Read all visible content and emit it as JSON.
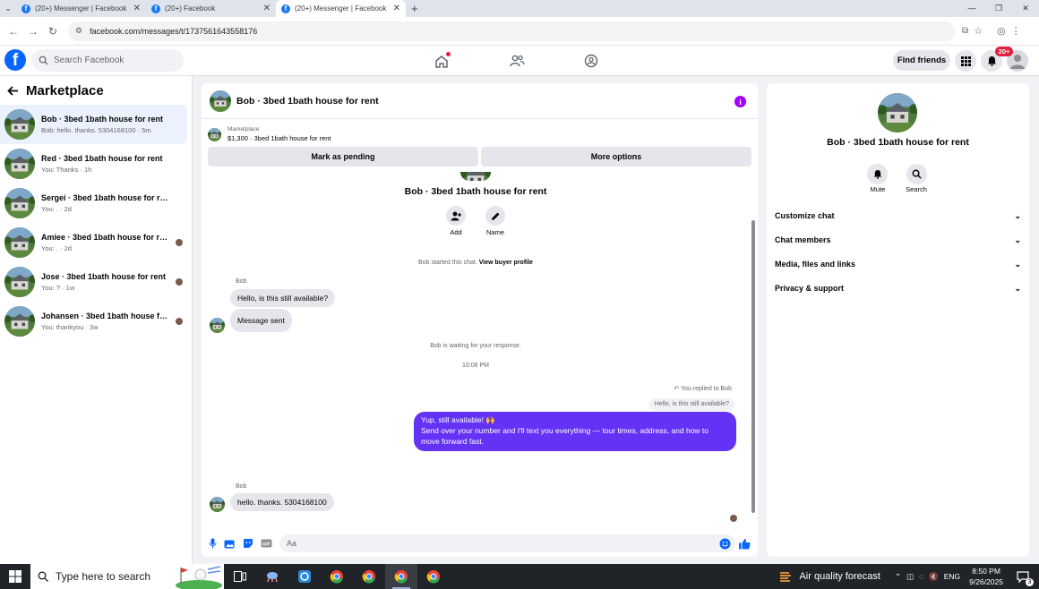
{
  "browser": {
    "tabs": [
      {
        "title": "(20+) Messenger | Facebook",
        "active": false
      },
      {
        "title": "(20+) Facebook",
        "active": false
      },
      {
        "title": "(20+) Messenger | Facebook",
        "active": true
      }
    ],
    "url": "facebook.com/messages/t/1737561643558176"
  },
  "header": {
    "search_placeholder": "Search Facebook",
    "find_friends": "Find friends",
    "notification_badge": "20+",
    "logo_letter": "f"
  },
  "sidebar": {
    "title": "Marketplace",
    "conversations": [
      {
        "name": "Bob · 3bed 1bath house for rent",
        "preview": "Bob: hello. thanks. 5304168100 · 5m",
        "selected": true,
        "seen": false
      },
      {
        "name": "Red · 3bed 1bath house for rent",
        "preview": "You: Thanks · 1h",
        "selected": false,
        "seen": false
      },
      {
        "name": "Sergei · 3bed 1bath house for rent",
        "preview": "You: . · 2d",
        "selected": false,
        "seen": false
      },
      {
        "name": "Amiee · 3bed 1bath house for rent",
        "preview": "You: . · 2d",
        "selected": false,
        "seen": true
      },
      {
        "name": "Jose · 3bed 1bath house for rent",
        "preview": "You: ? · 1w",
        "selected": false,
        "seen": true
      },
      {
        "name": "Johansen · 3bed 1bath house for...",
        "preview": "You: thankyou · 3w",
        "selected": false,
        "seen": true
      }
    ]
  },
  "chat": {
    "title": "Bob · 3bed 1bath house for rent",
    "marketplace_label": "Marketplace",
    "listing": "$1,300 · 3bed 1bath house for rent",
    "mark_pending": "Mark as pending",
    "more_options": "More options",
    "center_name": "Bob · 3bed 1bath house for rent",
    "add_label": "Add",
    "name_label": "Name",
    "started_text": "Bob started this chat.",
    "view_profile": "View buyer profile",
    "sender_name": "Bob",
    "msg1": "Hello, is this still available?",
    "msg2": "Message sent",
    "waiting": "Bob is waiting for your response.",
    "time": "10:06 PM",
    "replied_to": "You replied to Bob",
    "quoted": "Hello, is this still available?",
    "reply_line1": "Yup, still available! 🙌",
    "reply_line2": "Send over your number and I'll text you everything — tour times, address, and how to move forward fast.",
    "sender_name2": "Bob",
    "msg3": "hello. thanks. 5304168100",
    "composer_placeholder": "Aa"
  },
  "details": {
    "name": "Bob · 3bed 1bath house for rent",
    "mute": "Mute",
    "search": "Search",
    "sections": [
      "Customize chat",
      "Chat members",
      "Media, files and links",
      "Privacy & support"
    ]
  },
  "taskbar": {
    "search_placeholder": "Type here to search",
    "weather": "Air quality forecast",
    "lang": "ENG",
    "time": "8:50 PM",
    "date": "9/26/2025",
    "notif_count": "3"
  },
  "colors": {
    "accent": "#6332f5",
    "brand": "#0866ff",
    "selected": "#ebf2fd"
  }
}
